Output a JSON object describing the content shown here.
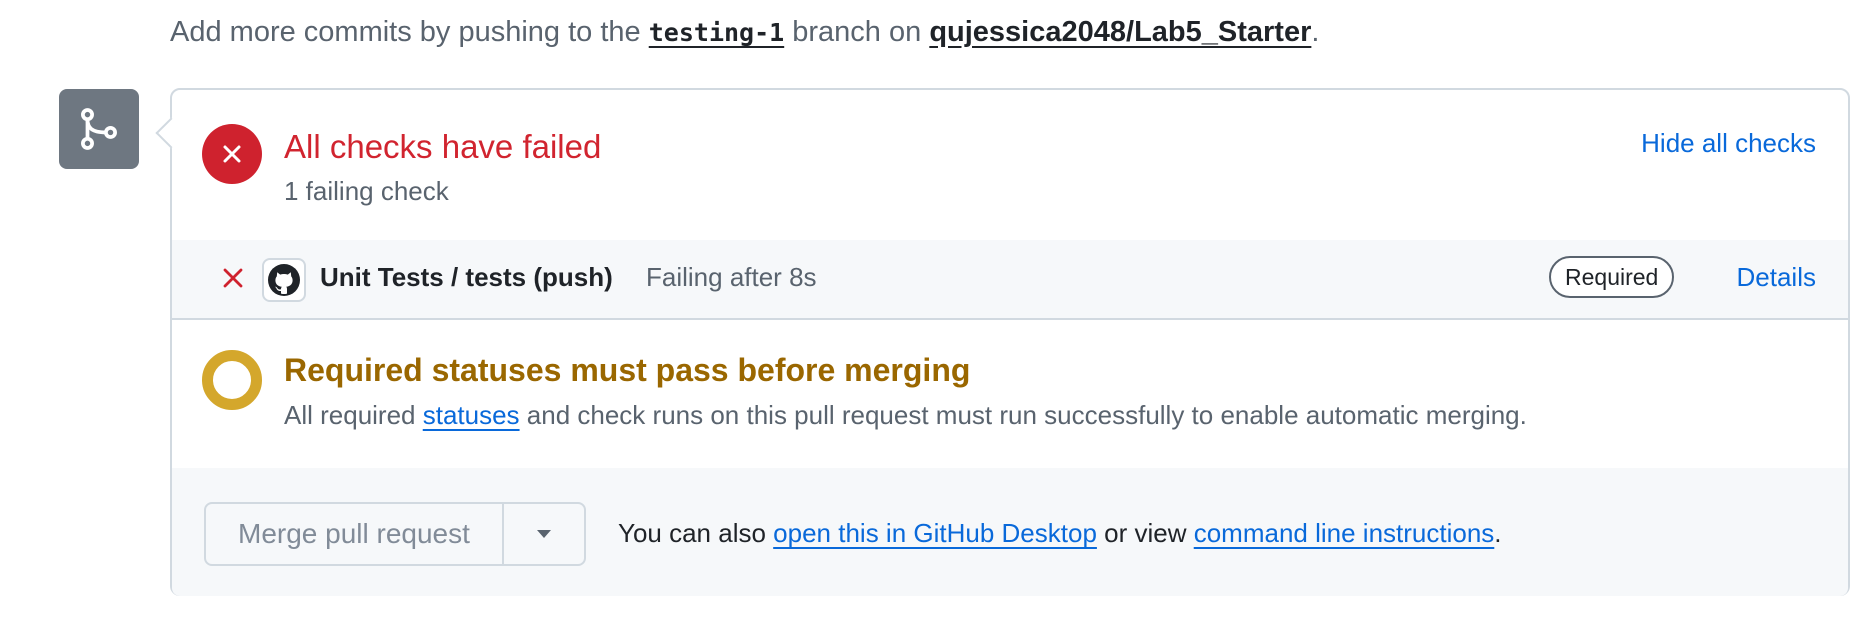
{
  "hint": {
    "prefix": "Add more commits by pushing to the ",
    "branch": "testing-1",
    "middle": " branch on ",
    "repo": "qujessica2048/Lab5_Starter",
    "suffix": "."
  },
  "checks": {
    "title": "All checks have failed",
    "subtitle": "1 failing check",
    "hide_label": "Hide all checks",
    "items": [
      {
        "name": "Unit Tests / tests (push)",
        "status": "Failing after 8s",
        "badge": "Required",
        "details_label": "Details"
      }
    ]
  },
  "required": {
    "title": "Required statuses must pass before merging",
    "desc_prefix": "All required ",
    "desc_link": "statuses",
    "desc_suffix": " and check runs on this pull request must run successfully to enable automatic merging."
  },
  "merge": {
    "button_label": "Merge pull request",
    "note_prefix": "You can also ",
    "desktop_link": "open this in GitHub Desktop",
    "note_middle": " or view ",
    "cli_link": "command line instructions",
    "note_suffix": "."
  },
  "icons": {
    "branch": "git-branch-icon",
    "fail": "x-icon",
    "pending": "dot-circle-icon",
    "avatar": "github-mark-icon",
    "dropdown": "triangle-down-icon"
  },
  "colors": {
    "danger": "#cf222e",
    "attention": "#9a6700",
    "pending_ring": "#d4a72c",
    "link": "#0969da",
    "muted": "#59636e"
  }
}
